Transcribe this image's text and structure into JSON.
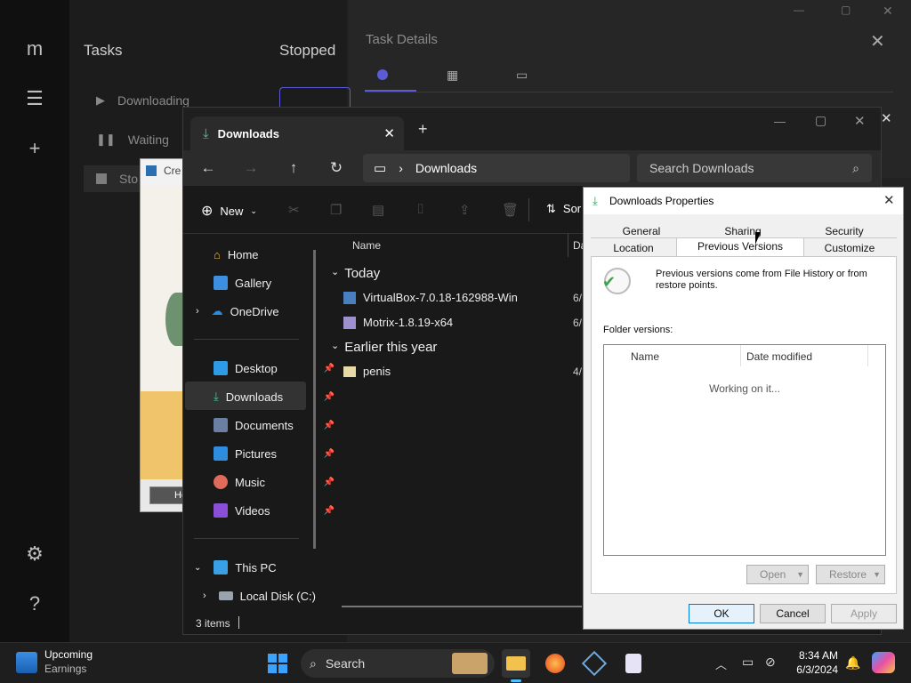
{
  "motrix": {
    "sidebar_title": "Tasks",
    "tasks": [
      {
        "label": "Downloading"
      },
      {
        "label": "Waiting"
      },
      {
        "label": "Sto"
      }
    ],
    "main_title": "Stopped",
    "details_title": "Task Details"
  },
  "vbox": {
    "title": "Cre",
    "button": "He"
  },
  "explorer": {
    "tab_title": "Downloads",
    "address": "Downloads",
    "search_placeholder": "Search Downloads",
    "new_label": "New",
    "sort_label": "Sor",
    "nav": [
      {
        "label": "Home",
        "pinned": false
      },
      {
        "label": "Gallery",
        "pinned": false
      },
      {
        "label": "OneDrive",
        "pinned": false
      },
      {
        "label": "Desktop",
        "pinned": true
      },
      {
        "label": "Downloads",
        "pinned": true
      },
      {
        "label": "Documents",
        "pinned": true
      },
      {
        "label": "Pictures",
        "pinned": true
      },
      {
        "label": "Music",
        "pinned": true
      },
      {
        "label": "Videos",
        "pinned": true
      },
      {
        "label": "This PC",
        "pinned": false
      },
      {
        "label": "Local Disk (C:)",
        "pinned": false
      }
    ],
    "columns": {
      "name": "Name",
      "date": "Da"
    },
    "groups": [
      {
        "label": "Today",
        "files": [
          {
            "name": "VirtualBox-7.0.18-162988-Win",
            "date": "6/"
          },
          {
            "name": "Motrix-1.8.19-x64",
            "date": "6/"
          }
        ]
      },
      {
        "label": "Earlier this year",
        "files": [
          {
            "name": "penis",
            "date": "4/"
          }
        ]
      }
    ],
    "status": "3 items"
  },
  "properties": {
    "title": "Downloads Properties",
    "tabs_row1": [
      "General",
      "Sharing",
      "Security"
    ],
    "tabs_row2": [
      "Location",
      "Previous Versions",
      "Customize"
    ],
    "info": "Previous versions come from File History or from restore points.",
    "folder_versions_label": "Folder versions:",
    "col_name": "Name",
    "col_date": "Date modified",
    "working": "Working on it...",
    "open": "Open",
    "restore": "Restore",
    "ok": "OK",
    "cancel": "Cancel",
    "apply": "Apply"
  },
  "taskbar": {
    "widget_title": "Upcoming",
    "widget_sub": "Earnings",
    "search": "Search",
    "time": "8:34 AM",
    "date": "6/3/2024"
  },
  "colors": {
    "accent": "#0a64d8",
    "download_green": "#3fcf8e"
  }
}
